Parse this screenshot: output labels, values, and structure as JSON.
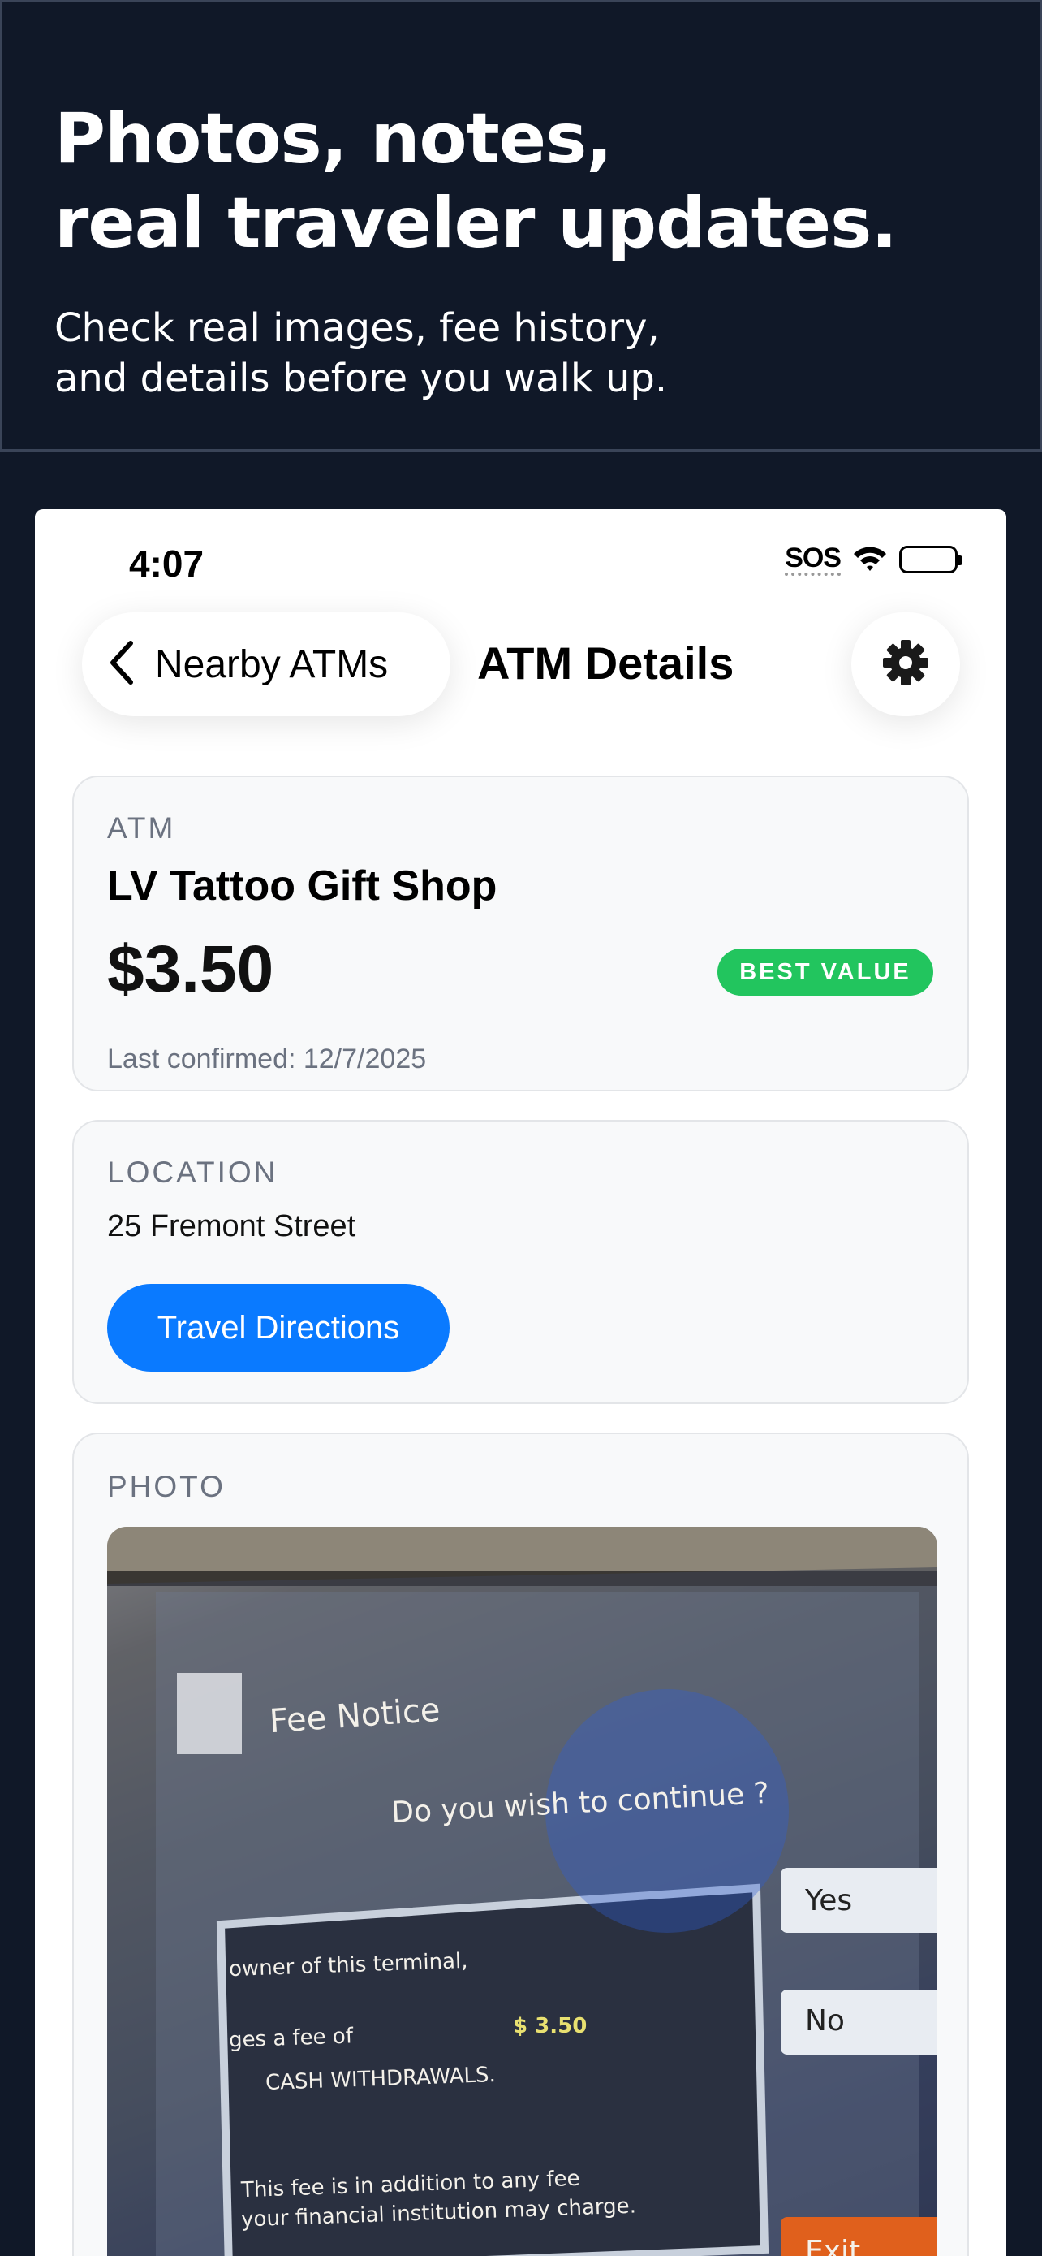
{
  "hero": {
    "title_line1": "Photos, notes,",
    "title_line2": "real traveler updates.",
    "subtitle_line1": "Check real images, fee history,",
    "subtitle_line2": "and details before you walk up."
  },
  "status_bar": {
    "time": "4:07",
    "carrier": "SOS"
  },
  "nav": {
    "back_label": "Nearby ATMs",
    "title": "ATM Details"
  },
  "atm_card": {
    "section_label": "ATM",
    "name": "LV Tattoo Gift Shop",
    "fee": "$3.50",
    "badge": "BEST VALUE",
    "last_confirmed": "Last confirmed: 12/7/2025"
  },
  "location_card": {
    "section_label": "LOCATION",
    "address": "25 Fremont Street",
    "directions_button": "Travel Directions"
  },
  "photo_card": {
    "section_label": "PHOTO",
    "photo_text": {
      "heading": "Fee Notice",
      "question": "Do you wish to continue ?",
      "yes": "Yes",
      "no": "No",
      "exit": "Exit",
      "line1": "owner of this terminal,",
      "line2": "ges a fee of",
      "amount": "$ 3.50",
      "line3": "CASH WITHDRAWALS.",
      "line4": "This fee is in addition to any fee",
      "line5": "your financial institution may charge."
    }
  },
  "colors": {
    "background": "#101828",
    "accent": "#0a7aff",
    "badge": "#22c55e"
  },
  "icons": [
    "chevron-left-icon",
    "gear-icon",
    "wifi-icon",
    "battery-icon"
  ]
}
